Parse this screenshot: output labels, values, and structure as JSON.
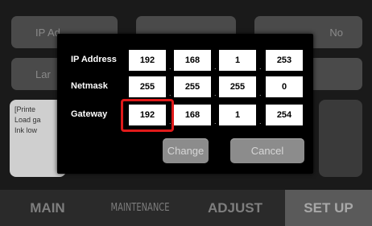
{
  "background": {
    "top_buttons": [
      "IP Ad",
      "",
      "No"
    ],
    "left_button": "Lar",
    "panel_lines": [
      "[Printe",
      "Load ga",
      "Ink low"
    ]
  },
  "dialog": {
    "rows": [
      {
        "label": "IP Address",
        "values": [
          "192",
          "168",
          "1",
          "253"
        ]
      },
      {
        "label": "Netmask",
        "values": [
          "255",
          "255",
          "255",
          "0"
        ]
      },
      {
        "label": "Gateway",
        "values": [
          "192",
          "168",
          "1",
          "254"
        ]
      }
    ],
    "change_label": "Change",
    "cancel_label": "Cancel"
  },
  "nav": {
    "items": [
      "MAIN",
      "MAINTENANCE",
      "ADJUST",
      "SET UP"
    ],
    "active": "SET UP"
  },
  "colors": {
    "highlight": "#e01a1a",
    "dialog_bg": "#000000",
    "field_bg": "#ffffff"
  }
}
